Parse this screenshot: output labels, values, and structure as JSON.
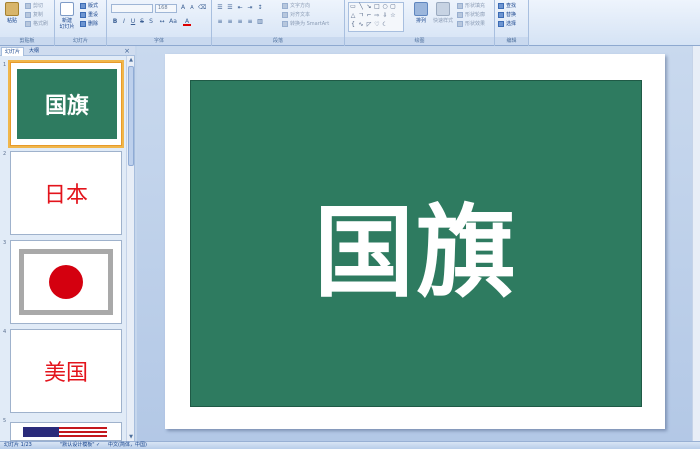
{
  "ribbon": {
    "clipboard": {
      "paste_label": "粘贴",
      "cut_label": "剪切",
      "copy_label": "复制",
      "format_painter_label": "格式刷",
      "group_label": "剪贴板"
    },
    "slides": {
      "new_slide_label": "新建\n幻灯片",
      "layout_label": "版式",
      "reset_label": "重设",
      "delete_label": "删除",
      "group_label": "幻灯片"
    },
    "font": {
      "font_size": "168",
      "group_label": "字体"
    },
    "paragraph": {
      "text_direction_label": "文字方向",
      "align_text_label": "对齐文本",
      "smartart_label": "转换为 SmartArt",
      "group_label": "段落"
    },
    "drawing": {
      "arrange_label": "排列",
      "quick_styles_label": "快速样式",
      "shape_fill_label": "形状填充",
      "shape_outline_label": "形状轮廓",
      "shape_effects_label": "形状效果",
      "group_label": "绘图"
    },
    "editing": {
      "find_label": "查找",
      "replace_label": "替换",
      "select_label": "选择",
      "group_label": "编辑"
    }
  },
  "panel": {
    "tabs": [
      "幻灯片",
      "大纲"
    ],
    "close_glyph": "×",
    "slides": [
      {
        "number": "1",
        "text": "国旗"
      },
      {
        "number": "2",
        "text": "日本"
      },
      {
        "number": "3",
        "text": ""
      },
      {
        "number": "4",
        "text": "美国"
      },
      {
        "number": "5",
        "text": ""
      }
    ]
  },
  "main": {
    "slide_title": "国旗"
  },
  "status": {
    "slide_counter": "幻灯片 1/23",
    "theme": "\"默认设计模板\"",
    "language": "中文(简体，中国)"
  },
  "colors": {
    "slide_green": "#2e7b60",
    "accent_red": "#e3141c"
  }
}
